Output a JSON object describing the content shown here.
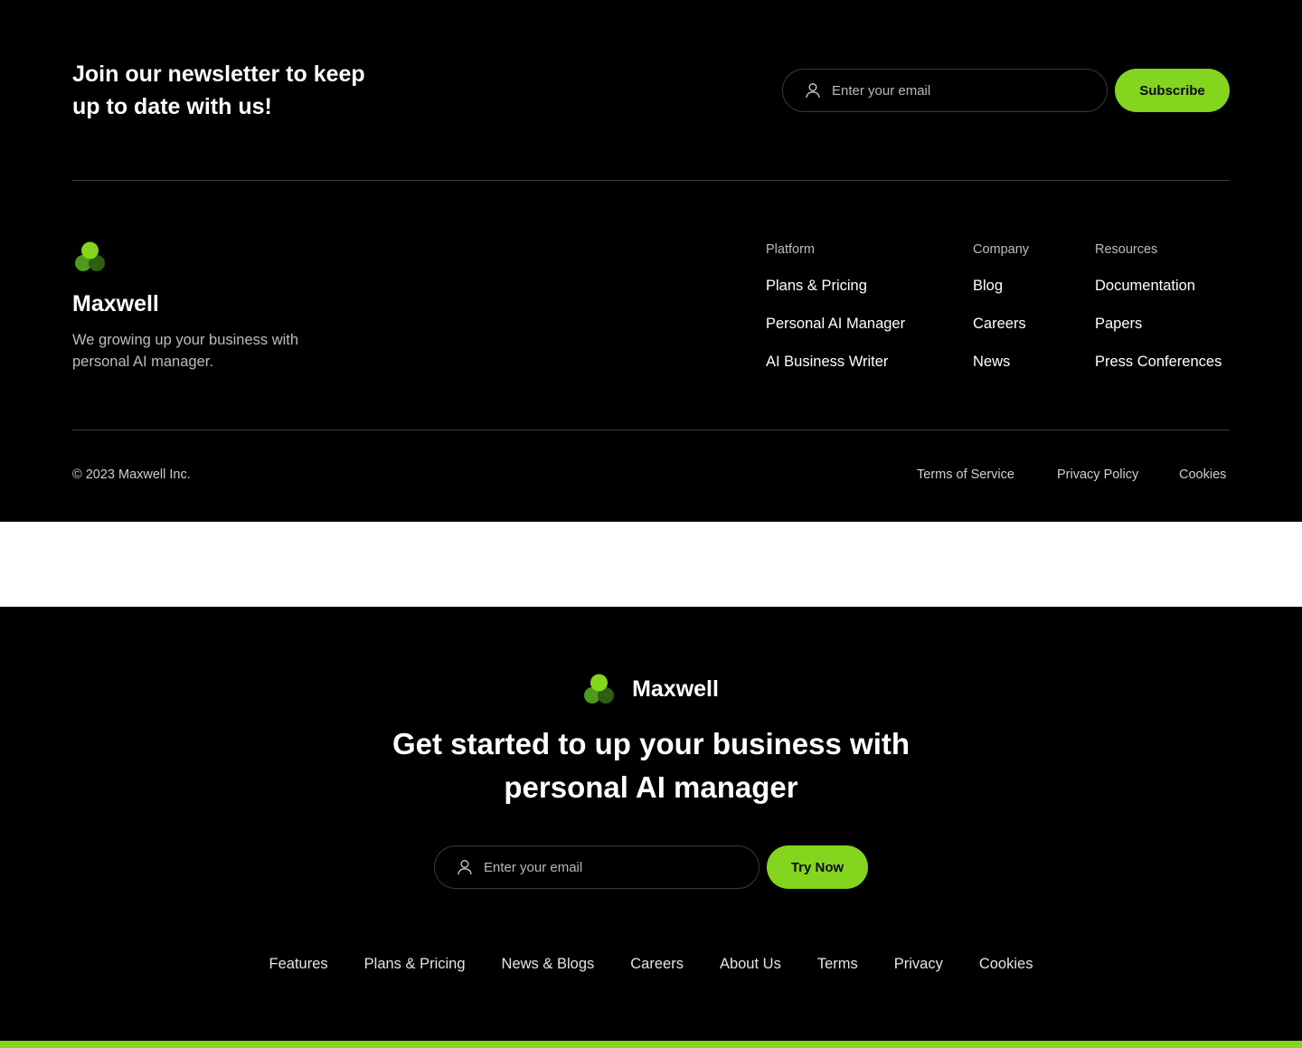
{
  "colors": {
    "accent": "#84D51E",
    "logo_light": "#84D51E",
    "logo_mid": "#4E9A1A",
    "logo_dark": "#2E5E10",
    "background": "#000000"
  },
  "newsletter": {
    "title": "Join our newsletter to keep up to date with us!",
    "email_placeholder": "Enter your email",
    "subscribe_label": "Subscribe"
  },
  "brand": {
    "name": "Maxwell",
    "tagline": "We growing up your business with personal AI manager."
  },
  "columns": [
    {
      "heading": "Platform",
      "links": [
        "Plans & Pricing",
        "Personal AI Manager",
        "AI Business Writer"
      ]
    },
    {
      "heading": "Company",
      "links": [
        "Blog",
        "Careers",
        "News"
      ]
    },
    {
      "heading": "Resources",
      "links": [
        "Documentation",
        "Papers",
        "Press Conferences"
      ]
    }
  ],
  "bottom": {
    "copyright": "© 2023 Maxwell Inc.",
    "legal_links": [
      "Terms of Service",
      "Privacy Policy",
      "Cookies"
    ]
  },
  "cta": {
    "brand_name": "Maxwell",
    "title": "Get started to up your business with personal AI manager",
    "email_placeholder": "Enter your email",
    "button_label": "Try Now"
  },
  "footer_nav": [
    "Features",
    "Plans & Pricing",
    "News & Blogs",
    "Careers",
    "About Us",
    "Terms",
    "Privacy",
    "Cookies"
  ]
}
